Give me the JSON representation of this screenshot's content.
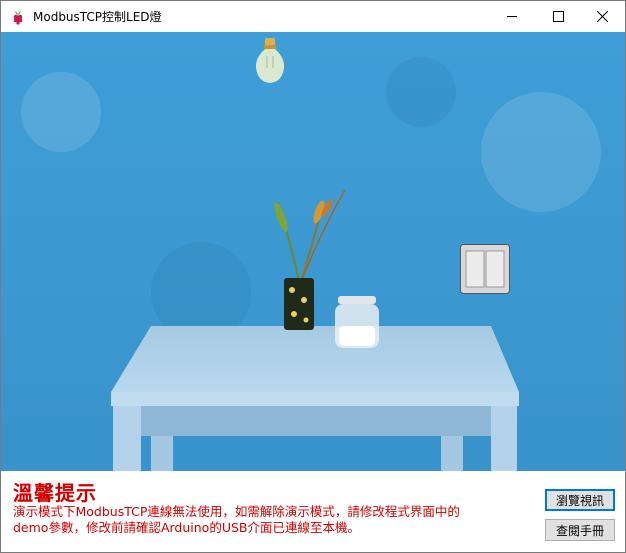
{
  "window": {
    "title": "ModbusTCP控制LED燈",
    "app_icon": "raspberry-icon",
    "minimize_icon": "minimize-icon",
    "maximize_icon": "maximize-icon",
    "close_icon": "close-icon"
  },
  "scene": {
    "bulb_state": "off",
    "switch_state": "off",
    "colors": {
      "wall": "#3d9bd3",
      "table": "#a9cfe9"
    }
  },
  "notice": {
    "title": "溫馨提示",
    "line1": "演示模式下ModbusTCP連線無法使用，如需解除演示模式，請修改程式界面中的",
    "line2": "demo參數，修改前請確認Arduino的USB介面已連線至本機。",
    "color": "#d40000"
  },
  "buttons": {
    "browse_label": "瀏覽視訊",
    "manual_label": "查閱手冊"
  }
}
